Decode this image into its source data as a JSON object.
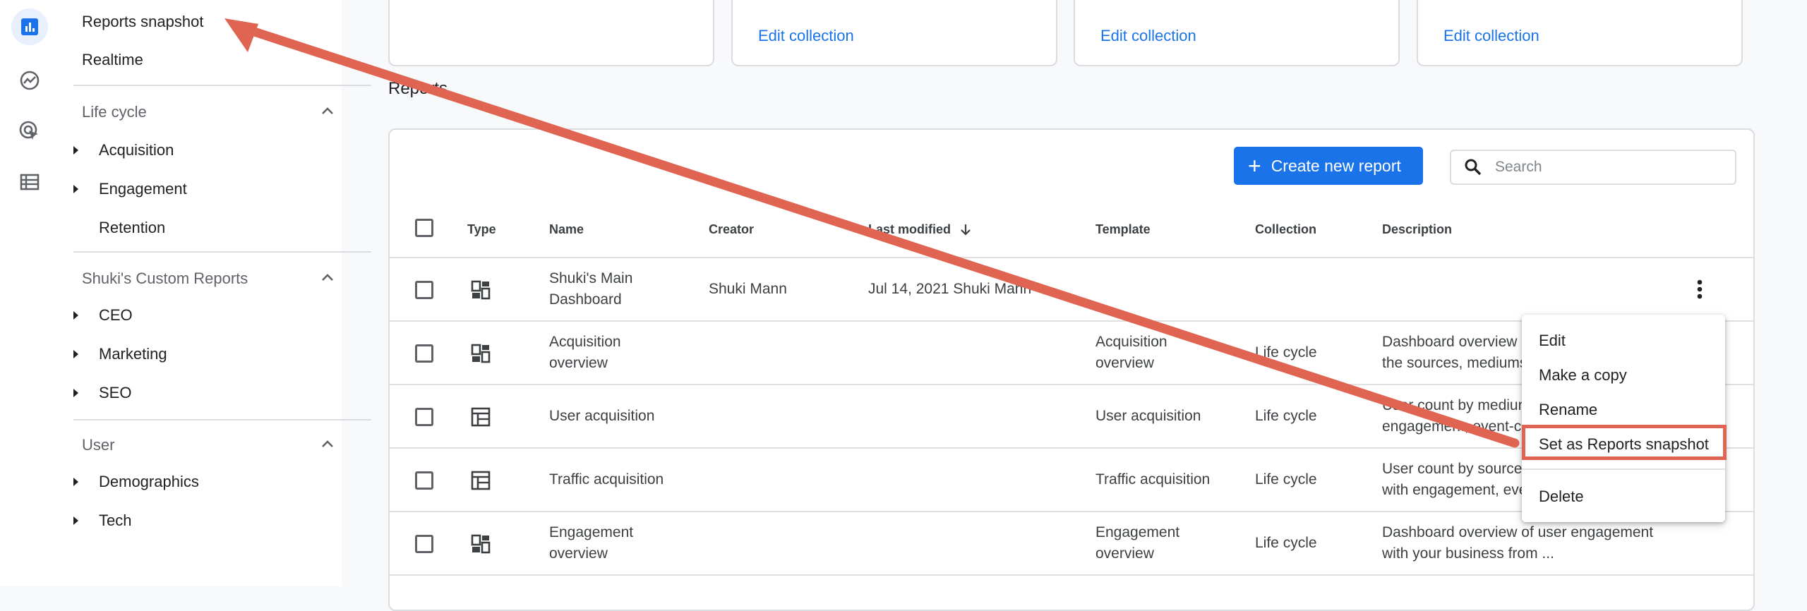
{
  "nav": {
    "top_links": [
      "Reports snapshot",
      "Realtime"
    ],
    "sections": [
      {
        "title": "Life cycle",
        "items": [
          "Acquisition",
          "Engagement",
          "Retention"
        ]
      },
      {
        "title": "Shuki's Custom Reports",
        "items": [
          "CEO",
          "Marketing",
          "SEO"
        ]
      },
      {
        "title": "User",
        "items": [
          "Demographics",
          "Tech"
        ]
      }
    ]
  },
  "collections": {
    "edit_label": "Edit collection"
  },
  "reports": {
    "title": "Reports",
    "create_label": "Create new report",
    "search_placeholder": "Search",
    "columns": [
      "Type",
      "Name",
      "Creator",
      "Last modified",
      "Template",
      "Collection",
      "Description"
    ],
    "rows": [
      {
        "type": "dashboard",
        "name": "Shuki's Main Dashboard",
        "creator": "Shuki Mann",
        "modified": "Jul 14, 2021 Shuki Mann",
        "template": "",
        "collection": "",
        "description": ""
      },
      {
        "type": "dashboard",
        "name": "Acquisition overview",
        "creator": "",
        "modified": "",
        "template": "Acquisition overview",
        "collection": "Life cycle",
        "description": "Dashboard overview of the sources, mediums"
      },
      {
        "type": "table",
        "name": "User acquisition",
        "creator": "",
        "modified": "",
        "template": "User acquisition",
        "collection": "Life cycle",
        "description": "User count by medium engagement, event-c"
      },
      {
        "type": "table",
        "name": "Traffic acquisition",
        "creator": "",
        "modified": "",
        "template": "Traffic acquisition",
        "collection": "Life cycle",
        "description": "User count by source with engagement, eve"
      },
      {
        "type": "dashboard",
        "name": "Engagement overview",
        "creator": "",
        "modified": "",
        "template": "Engagement overview",
        "collection": "Life cycle",
        "description": "Dashboard overview of user engagement with your business from ..."
      }
    ]
  },
  "menu": {
    "items": [
      "Edit",
      "Make a copy",
      "Rename",
      "Set as Reports snapshot",
      "Delete"
    ],
    "highlighted": "Set as Reports snapshot"
  },
  "colors": {
    "accent": "#1a73e8",
    "annotation": "#e06452"
  }
}
